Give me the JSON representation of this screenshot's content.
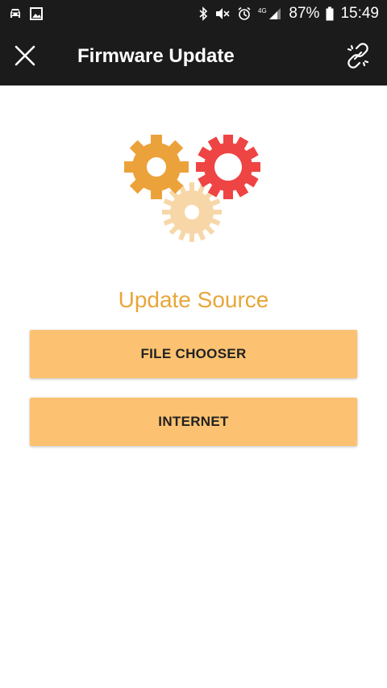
{
  "status_bar": {
    "battery": "87%",
    "time": "15:49",
    "network": "4G",
    "icons": [
      "car-icon",
      "image-icon",
      "bluetooth-icon",
      "mute-icon",
      "alarm-icon",
      "signal-icon",
      "battery-icon"
    ]
  },
  "app_bar": {
    "title": "Firmware Update",
    "close_icon": "close-icon",
    "link_icon": "link-off-icon"
  },
  "illustration": {
    "icons": [
      "gear-orange-icon",
      "gear-red-icon",
      "gear-light-icon"
    ],
    "colors": {
      "orange": "#ECA23A",
      "red": "#EE4444",
      "light": "#F7D7A8"
    }
  },
  "main": {
    "heading": "Update Source",
    "buttons": [
      {
        "label": "FILE CHOOSER"
      },
      {
        "label": "INTERNET"
      }
    ]
  },
  "colors": {
    "bar_background": "#1B1B1B",
    "heading": "#E8A63A",
    "button_background": "#FCC271"
  }
}
